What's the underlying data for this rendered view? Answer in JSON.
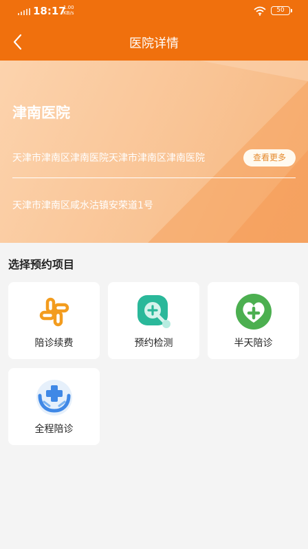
{
  "status_bar": {
    "time": "18:17",
    "net_speed_value": "1.00",
    "net_speed_unit": "KB/s",
    "battery": "50"
  },
  "nav": {
    "title": "医院详情"
  },
  "hospital": {
    "name": "津南医院",
    "description": "天津市津南区津南医院天津市津南区津南医院",
    "more_label": "查看更多",
    "address": "天津市津南区咸水沽镇安荣道1号"
  },
  "section": {
    "title": "选择预约项目"
  },
  "services": [
    {
      "label": "陪诊续费",
      "icon": "pinwheel-icon"
    },
    {
      "label": "预约检测",
      "icon": "magnifier-plus-icon"
    },
    {
      "label": "半天陪诊",
      "icon": "heart-cross-icon"
    },
    {
      "label": "全程陪诊",
      "icon": "hands-cross-icon"
    }
  ],
  "colors": {
    "primary": "#f0700d",
    "banner": "#f9c495",
    "teal": "#2ab89a",
    "green": "#4caf50",
    "blue": "#3f88e6",
    "orange_icon": "#f39c1e"
  }
}
